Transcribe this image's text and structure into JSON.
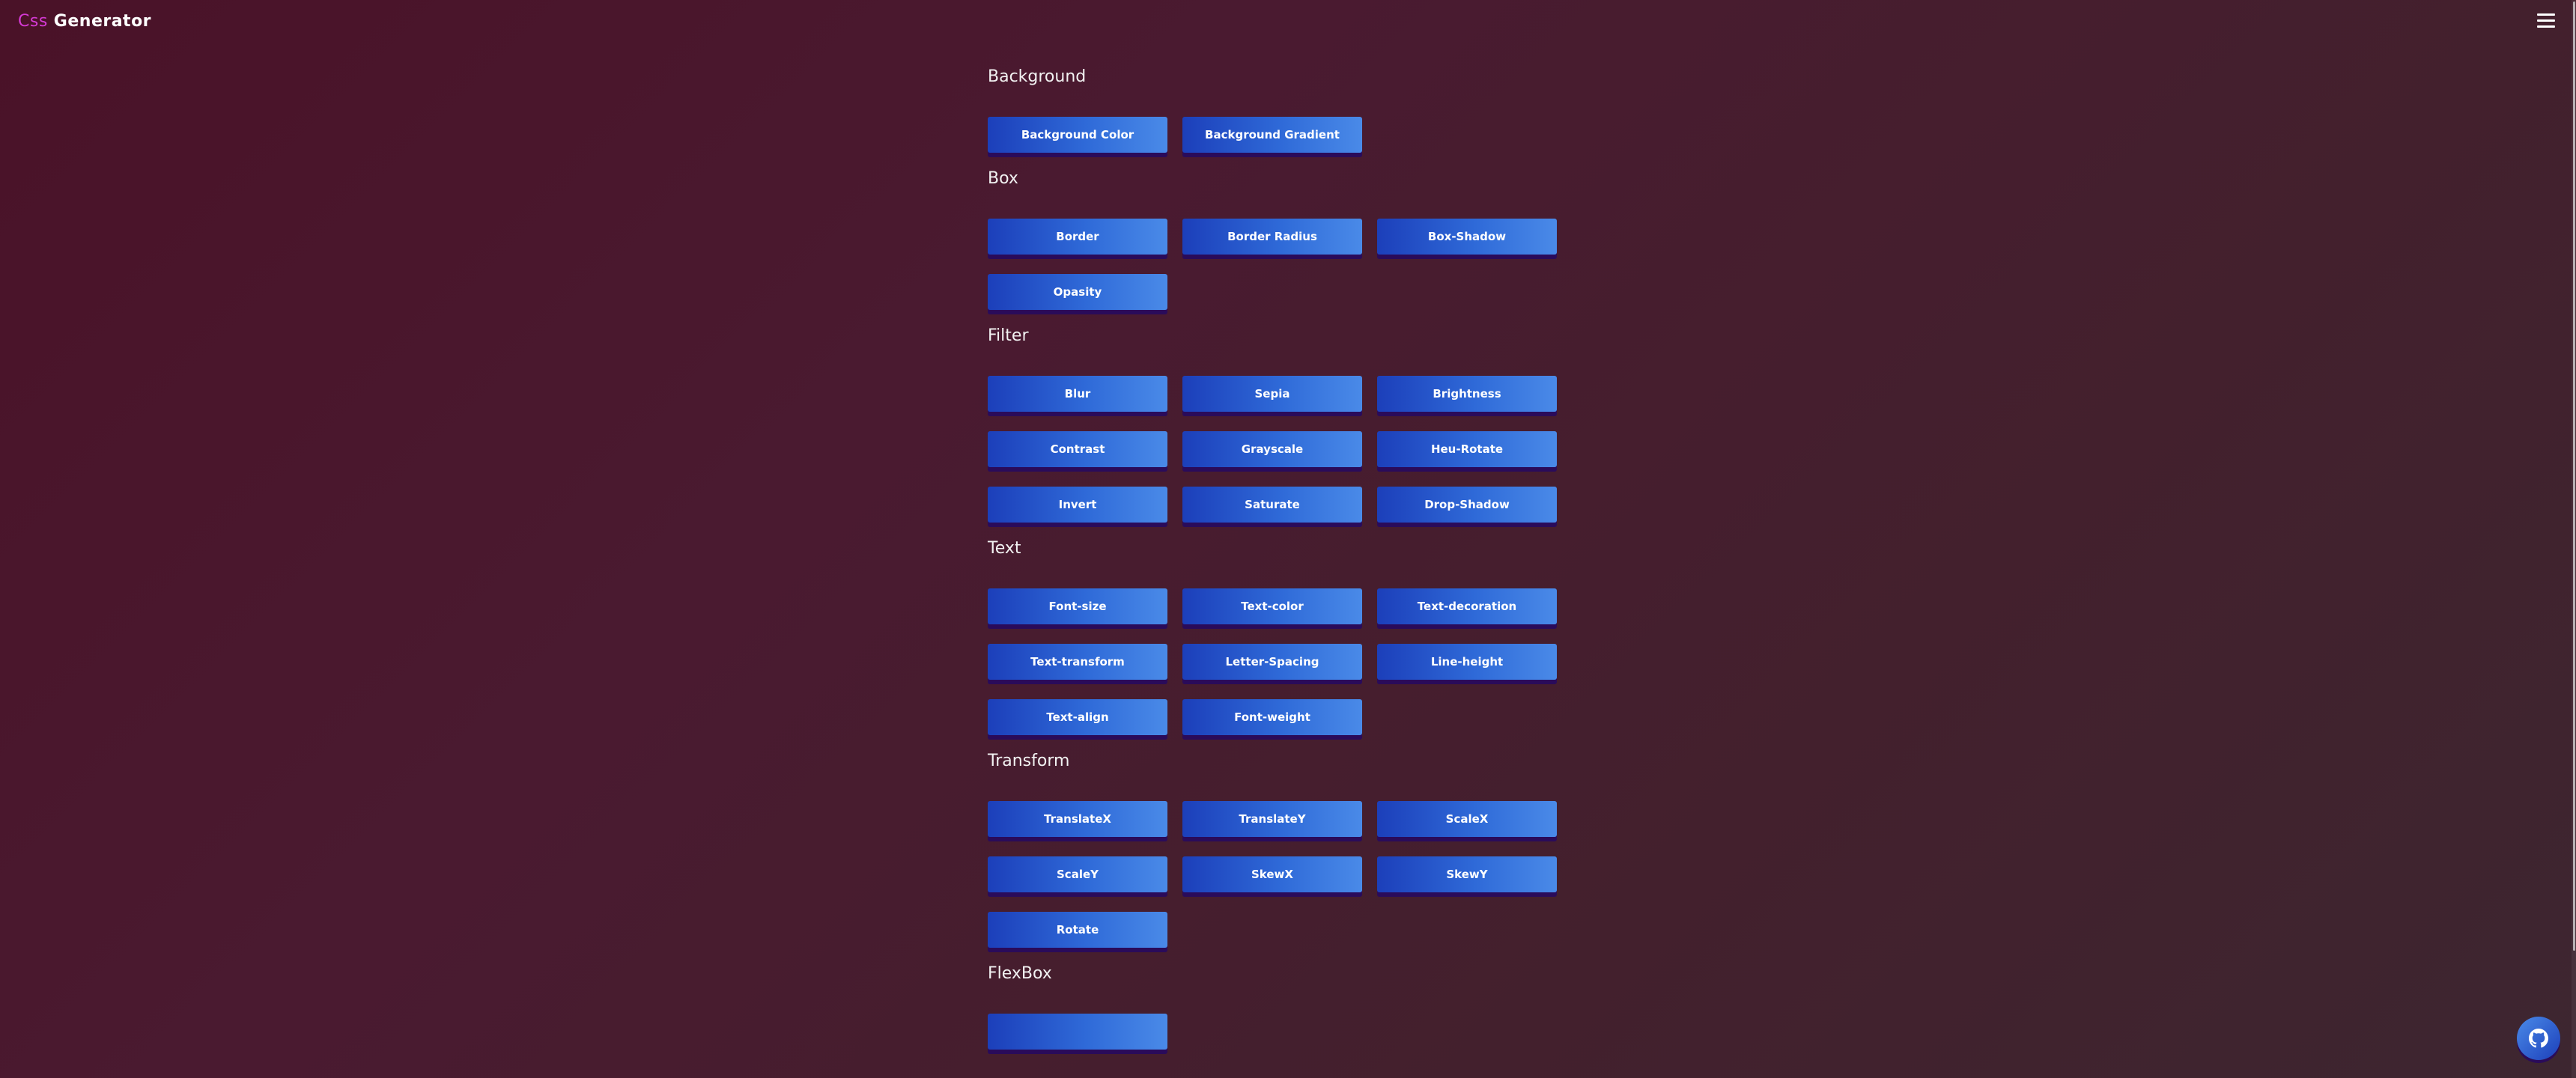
{
  "header": {
    "logo_accent": "Css",
    "logo_main": "Generator"
  },
  "sections": [
    {
      "title": "Background",
      "buttons": [
        "Background Color",
        "Background Gradient"
      ]
    },
    {
      "title": "Box",
      "buttons": [
        "Border",
        "Border Radius",
        "Box-Shadow",
        "Opasity"
      ]
    },
    {
      "title": "Filter",
      "buttons": [
        "Blur",
        "Sepia",
        "Brightness",
        "Contrast",
        "Grayscale",
        "Heu-Rotate",
        "Invert",
        "Saturate",
        "Drop-Shadow"
      ]
    },
    {
      "title": "Text",
      "buttons": [
        "Font-size",
        "Text-color",
        "Text-decoration",
        "Text-transform",
        "Letter-Spacing",
        "Line-height",
        "Text-align",
        "Font-weight"
      ]
    },
    {
      "title": "Transform",
      "buttons": [
        "TranslateX",
        "TranslateY",
        "ScaleX",
        "ScaleY",
        "SkewX",
        "SkewY",
        "Rotate"
      ]
    },
    {
      "title": "FlexBox",
      "buttons": [
        ""
      ]
    }
  ],
  "icons": {
    "menu": "hamburger-menu-icon",
    "github": "github-icon"
  },
  "colors": {
    "accent": "#d63ad6",
    "button_start": "#1c3fba",
    "button_end": "#4a8ae8",
    "button_shadow": "#2a0b5a"
  }
}
